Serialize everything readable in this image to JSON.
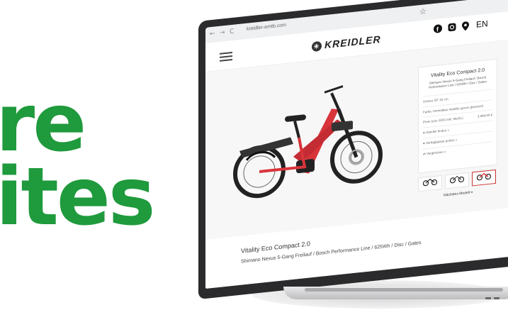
{
  "hero": {
    "line1": "re",
    "line2": "ites"
  },
  "browser": {
    "back": "←",
    "forward": "→",
    "reload": "C",
    "url": "kreidler-emtb.com",
    "star": "☆"
  },
  "header": {
    "logo_text": "KREIDLER",
    "logo_mark": "✳",
    "social_icons": [
      "facebook-icon",
      "instagram-icon",
      "location-icon"
    ],
    "lang": "EN"
  },
  "product": {
    "title": "Vitality Eco Compact 2.0",
    "subtitle": "Shimano Nexus 5-Gang Freilauf / Bosch Performance Line / 625Wh / Disc / Gates",
    "size_label": "Umzeu 20\" 42 cm",
    "color_label": "Farbe: bmmattlau metallic genoo glanzend",
    "price_label": "Preis (unv. ERG inkl. MwSt.)",
    "price": "3.999,90 €",
    "actions": [
      "Händler finden »",
      "Verfügbarkeit prüfen »",
      "Vergleichen »"
    ],
    "next": "Nächstes Modell",
    "next_icon": ">"
  },
  "thumbnails": [
    "bike-thumb-black",
    "bike-thumb-dark",
    "bike-thumb-red"
  ],
  "colors": {
    "accent": "#1f9a3d",
    "bike_red": "#d8343a"
  }
}
